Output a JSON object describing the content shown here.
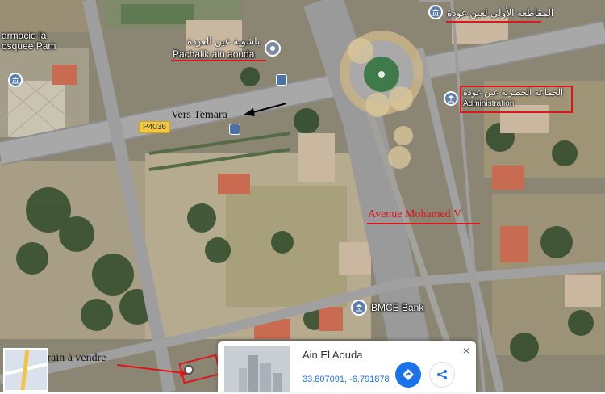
{
  "map": {
    "road_badge": "P4036",
    "annotations": {
      "vers_temara": "Vers Temara",
      "avenue": "Avenue Mohamed V",
      "terrain": "Terrain à vendre"
    },
    "pois": {
      "pachalik_ar": "باشوية عين العودة",
      "pachalik_fr": "Pachalik ain aouda",
      "pharmacie_line1": "armacie la",
      "pharmacie_line2": "osquee Pam",
      "moukataa_ar": "المقاطعة الأولى لعين عودة",
      "commune_ar": "الجماعة الحضرية عين عودة",
      "commune_fr": "Administration",
      "bank": "BMCE Bank"
    },
    "colors": {
      "annotation_red": "#e0141b",
      "road_badge": "#f5c842",
      "poi_blue": "#5c7fb0",
      "action_blue": "#1a73e8"
    }
  },
  "card": {
    "title": "Ain El Aouda",
    "coords": "33.807091, -6.791878",
    "close": "×",
    "directions_icon": "directions-icon",
    "share_icon": "share-icon"
  }
}
